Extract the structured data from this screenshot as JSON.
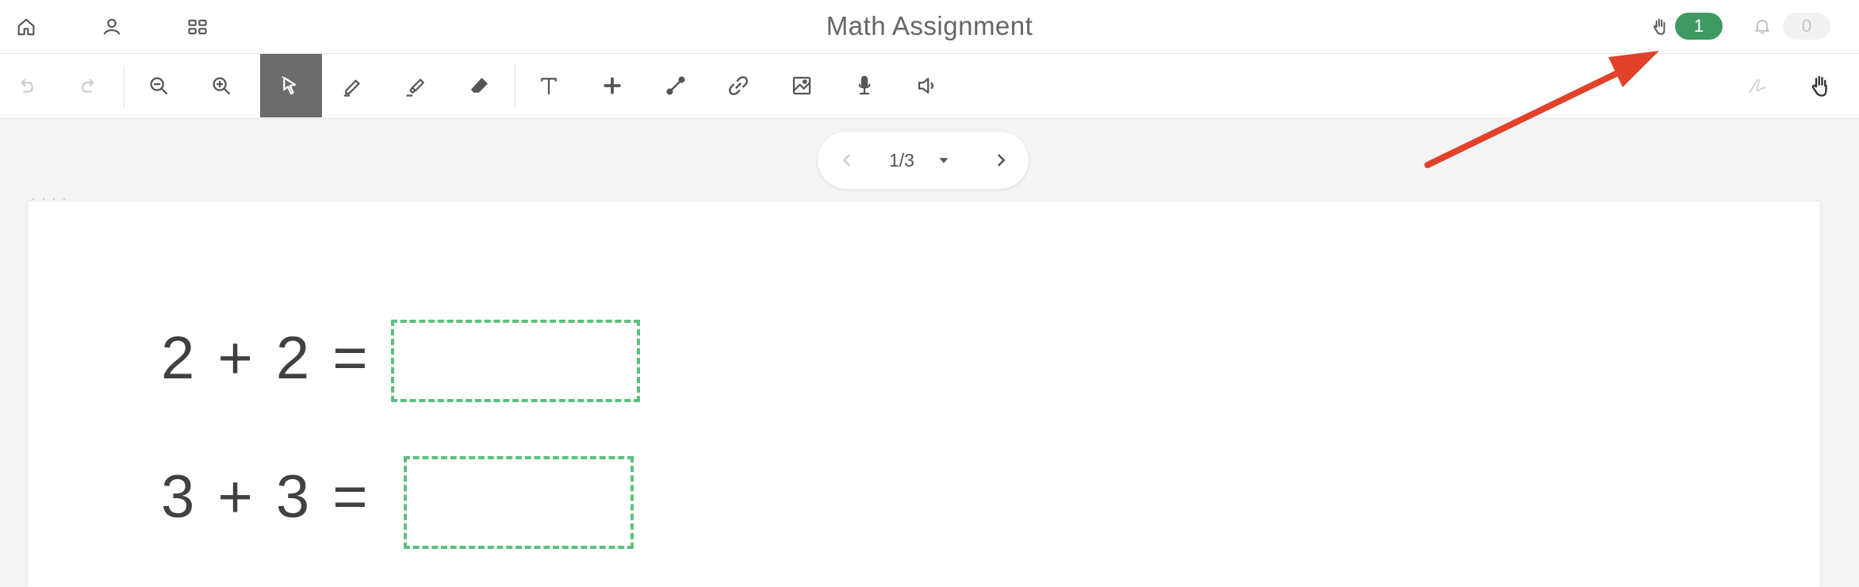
{
  "header": {
    "title": "Math Assignment",
    "raised_hands_count": "1",
    "notifications_count": "0"
  },
  "pagination": {
    "current_label": "1/3"
  },
  "worksheet": {
    "equations": [
      {
        "text": "2 + 2 ="
      },
      {
        "text": "3 + 3 ="
      }
    ]
  },
  "colors": {
    "accent_green": "#3e9a62",
    "answer_box_border": "#5cbf82",
    "active_tool_bg": "#6b6b6b",
    "annotation_arrow": "#e2412a"
  },
  "icons": {
    "top": [
      "home-icon",
      "user-icon",
      "grid-icon",
      "raise-hand-icon",
      "bell-icon"
    ],
    "toolbar": [
      "undo-icon",
      "redo-icon",
      "zoom-out-icon",
      "zoom-in-icon",
      "select-icon",
      "pen-icon",
      "highlighter-icon",
      "eraser-icon",
      "text-icon",
      "plus-icon",
      "line-icon",
      "link-icon",
      "image-icon",
      "microphone-icon",
      "speaker-icon",
      "signature-icon",
      "hand-icon"
    ]
  }
}
